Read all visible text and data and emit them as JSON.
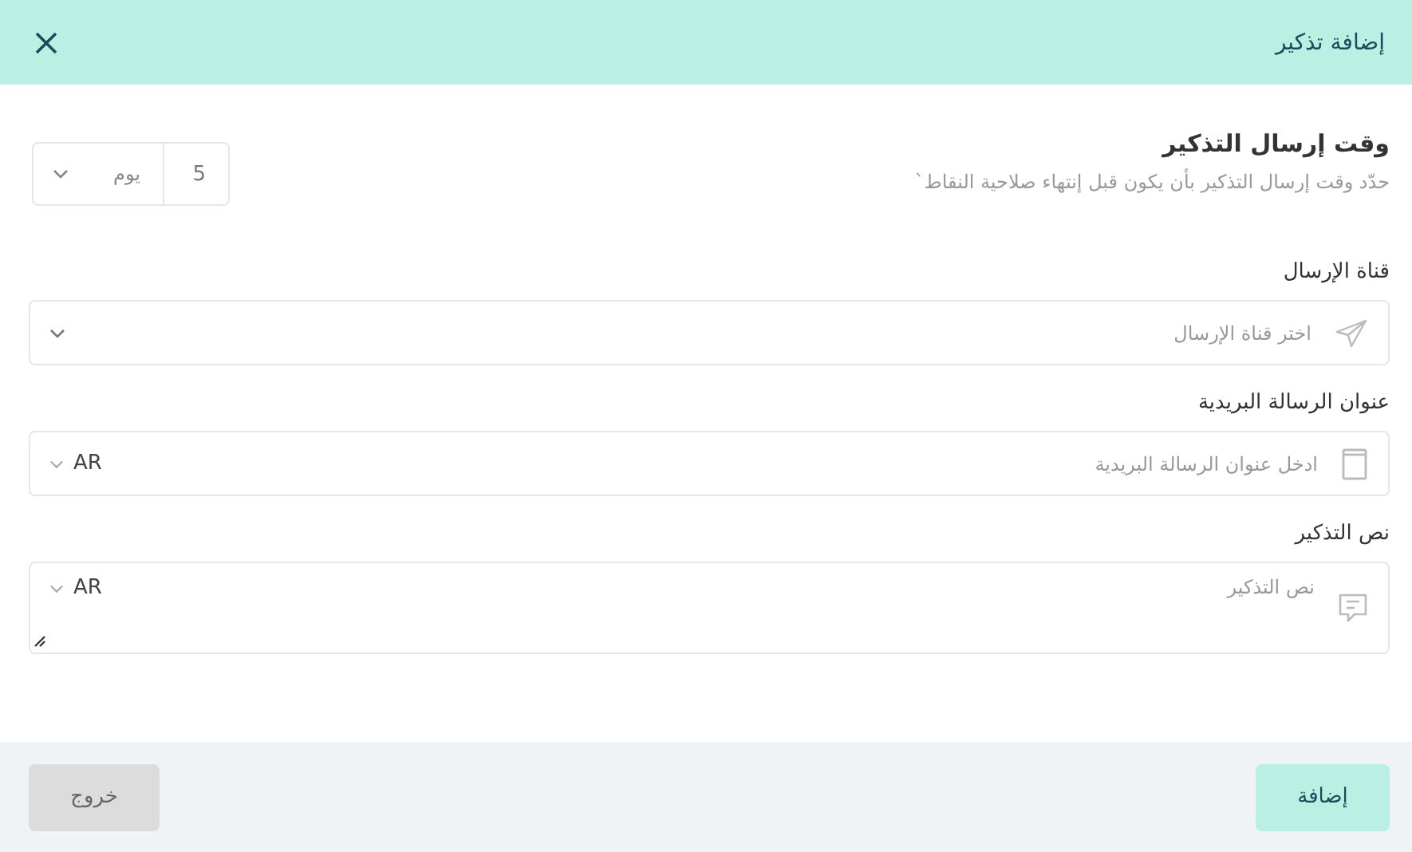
{
  "header": {
    "title": "إضافة تذكير"
  },
  "timing": {
    "title": "وقت إرسال التذكير",
    "description": "حدّد وقت إرسال التذكير بأن يكون قبل إنتهاء صلاحية النقاط`",
    "amount": "5",
    "unit": "يوم"
  },
  "fields": [
    {
      "kind": "select",
      "label": "قناة الإرسال",
      "placeholder": "اختر قناة الإرسال"
    },
    {
      "kind": "input",
      "label": "عنوان الرسالة البريدية",
      "placeholder": "ادخل عنوان الرسالة البريدية",
      "language": "AR"
    },
    {
      "kind": "textarea",
      "label": "نص التذكير",
      "placeholder": "نص التذكير",
      "language": "AR"
    }
  ],
  "footer": {
    "submit": "إضافة",
    "exit": "خروج"
  }
}
